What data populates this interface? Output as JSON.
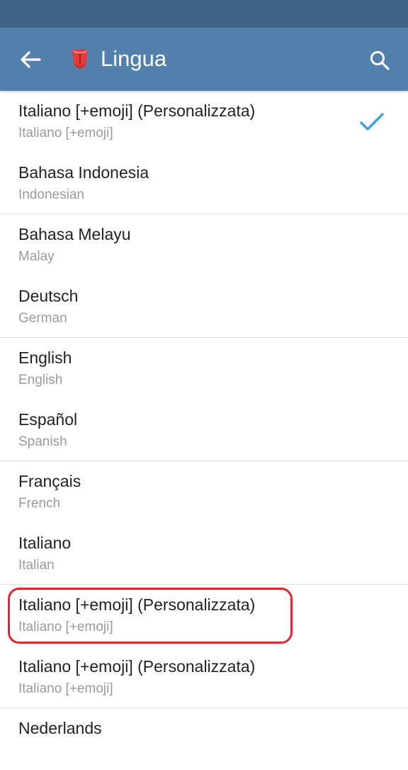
{
  "app_bar": {
    "title": "Lingua",
    "title_emoji": "tongue-emoji",
    "back_icon": "arrow-left-icon",
    "search_icon": "search-icon",
    "color": "#5281ad",
    "status_color": "#3f6485"
  },
  "languages": [
    {
      "name": "Italiano [+emoji] (Personalizzata)",
      "sub": "Italiano [+emoji]",
      "selected": true
    },
    {
      "name": "Bahasa Indonesia",
      "sub": "Indonesian"
    },
    {
      "name": "Bahasa Melayu",
      "sub": "Malay"
    },
    {
      "name": "Deutsch",
      "sub": "German"
    },
    {
      "name": "English",
      "sub": "English"
    },
    {
      "name": "Español",
      "sub": "Spanish"
    },
    {
      "name": "Français",
      "sub": "French"
    },
    {
      "name": "Italiano",
      "sub": "Italian"
    },
    {
      "name": "Italiano [+emoji] (Personalizzata)",
      "sub": "Italiano [+emoji]",
      "highlighted": true
    },
    {
      "name": "Italiano [+emoji] (Personalizzata)",
      "sub": "Italiano [+emoji]"
    },
    {
      "name": "Nederlands",
      "sub": ""
    }
  ],
  "colors": {
    "check": "#4a9fe0",
    "highlight_border": "#e0262e"
  }
}
